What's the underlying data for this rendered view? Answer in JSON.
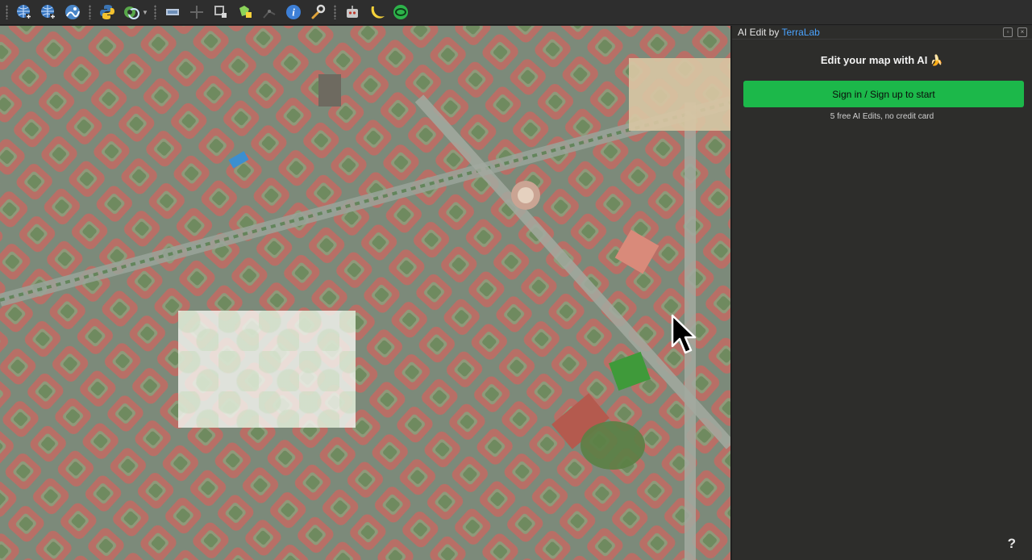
{
  "toolbar": {
    "buttons": [
      {
        "name": "add-wms-layer-icon",
        "color": "#3a78c2"
      },
      {
        "name": "add-wfs-layer-icon",
        "color": "#3a78c2"
      },
      {
        "name": "add-arcgis-layer-icon",
        "color": "#4a86c8"
      },
      {
        "name": "python-console-icon",
        "color": "#f2c12e"
      },
      {
        "name": "plugin-manager-icon",
        "color": "#58a74a"
      },
      {
        "name": "pan-icon",
        "color": "#6e8fb8"
      },
      {
        "name": "add-feature-icon",
        "color": "#666666"
      },
      {
        "name": "vertex-tool-icon",
        "color": "#b8b8b8"
      },
      {
        "name": "select-features-icon",
        "color": "#8bd35a"
      },
      {
        "name": "node-tool-icon",
        "color": "#555555"
      },
      {
        "name": "identify-icon",
        "color": "#3d7fd6"
      },
      {
        "name": "wrench-icon",
        "color": "#e0a33a"
      },
      {
        "name": "robot-icon",
        "color": "#c9c9c9"
      },
      {
        "name": "banana-icon",
        "color": "#f5d23a"
      },
      {
        "name": "terralab-icon",
        "color": "#2db34a"
      }
    ]
  },
  "panel": {
    "title_prefix": "AI Edit by ",
    "title_brand": "TerraLab",
    "heading": "Edit your map with AI 🍌",
    "signin_label": "Sign in / Sign up to start",
    "subtext": "5 free AI Edits, no credit card",
    "help_label": "?",
    "accent": "#1cb84a",
    "brand_color": "#4aa3ff"
  }
}
